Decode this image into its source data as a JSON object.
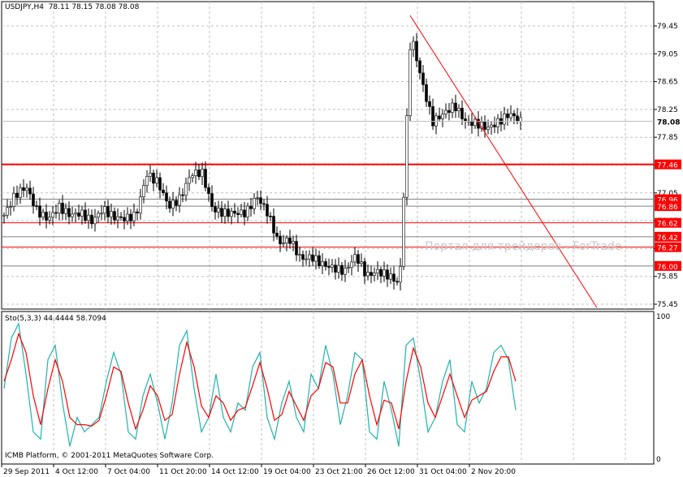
{
  "header": {
    "title": "USDJPY,H4",
    "ohlc": "78.11 78.15 78.08 78.08"
  },
  "stoch": {
    "title": "Sto(5,3,3)",
    "values": "44.4444 58.7094",
    "max_label": "100",
    "min_label": "0"
  },
  "copyright": "ICMB Platform, © 2001-2011 MetaQuotes Software Corp.",
  "watermark": "Портал для трейдеров - ForTrade",
  "colors": {
    "bull": "#00ff00",
    "candle": "#000000",
    "level": "#ff0000",
    "gray_level": "#808080",
    "main": "#20b2aa",
    "signal": "#ff0000"
  },
  "chart_data": {
    "type": "candlestick",
    "symbol": "USDJPY",
    "timeframe": "H4",
    "ylim": [
      75.35,
      79.6
    ],
    "y_ticks": [
      "79.45",
      "79.05",
      "78.65",
      "78.25",
      "77.85",
      "77.45",
      "77.05",
      "76.65",
      "76.25",
      "75.85",
      "75.45"
    ],
    "x_ticks": [
      "29 Sep 2011",
      "4 Oct 12:00",
      "7 Oct 04:00",
      "11 Oct 20:00",
      "14 Oct 12:00",
      "19 Oct 04:00",
      "23 Oct 21:00",
      "26 Oct 12:00",
      "31 Oct 04:00",
      "2 Nov 20:00"
    ],
    "close_path": [
      76.73,
      77.02,
      77.14,
      76.79,
      76.67,
      76.85,
      76.73,
      76.76,
      76.64,
      76.82,
      76.7,
      76.68,
      76.73,
      77.32,
      77.2,
      76.85,
      76.97,
      77.32,
      77.35,
      76.81,
      76.76,
      76.76,
      76.76,
      77.0,
      76.76,
      76.32,
      76.38,
      76.1,
      76.13,
      76.02,
      75.97,
      75.92,
      76.15,
      75.86,
      75.92,
      75.86,
      75.74,
      79.35,
      78.66,
      78.07,
      78.19,
      78.31,
      78.07,
      78.05,
      77.98,
      78.07,
      78.19,
      78.08
    ],
    "current_price": "78.08",
    "levels": [
      {
        "price": 77.46,
        "label": "77.46",
        "kind": "red-thick"
      },
      {
        "price": 76.96,
        "label": "76.96",
        "kind": "gray"
      },
      {
        "price": 76.86,
        "label": "76.86",
        "kind": "gray"
      },
      {
        "price": 76.62,
        "label": "76.62",
        "kind": "red"
      },
      {
        "price": 76.42,
        "label": "76.42",
        "kind": "gray"
      },
      {
        "price": 76.27,
        "label": "76.27",
        "kind": "red"
      },
      {
        "price": 76.0,
        "label": "76.00",
        "kind": "gray"
      }
    ],
    "trendline": {
      "from": [
        505,
        79.6
      ],
      "to": [
        735,
        75.4
      ]
    },
    "stochastic": {
      "ylim": [
        0,
        100
      ],
      "main": [
        50,
        85,
        95,
        60,
        20,
        15,
        70,
        80,
        40,
        10,
        30,
        20,
        25,
        30,
        55,
        75,
        60,
        20,
        15,
        45,
        60,
        40,
        15,
        40,
        80,
        90,
        50,
        20,
        30,
        60,
        30,
        20,
        40,
        35,
        65,
        75,
        30,
        15,
        40,
        55,
        30,
        20,
        60,
        50,
        80,
        60,
        25,
        45,
        75,
        70,
        20,
        15,
        55,
        35,
        10,
        80,
        85,
        55,
        20,
        30,
        55,
        70,
        25,
        20,
        55,
        40,
        50,
        75,
        80,
        70,
        35
      ],
      "signal": [
        55,
        70,
        88,
        75,
        45,
        25,
        50,
        70,
        55,
        30,
        25,
        25,
        24,
        28,
        45,
        65,
        62,
        40,
        22,
        35,
        52,
        45,
        28,
        32,
        60,
        82,
        65,
        38,
        30,
        45,
        40,
        28,
        35,
        37,
        52,
        68,
        50,
        28,
        32,
        48,
        38,
        28,
        45,
        50,
        68,
        65,
        40,
        40,
        60,
        70,
        45,
        25,
        42,
        40,
        22,
        55,
        78,
        65,
        40,
        30,
        45,
        60,
        45,
        30,
        42,
        45,
        48,
        62,
        72,
        72,
        55
      ]
    }
  }
}
